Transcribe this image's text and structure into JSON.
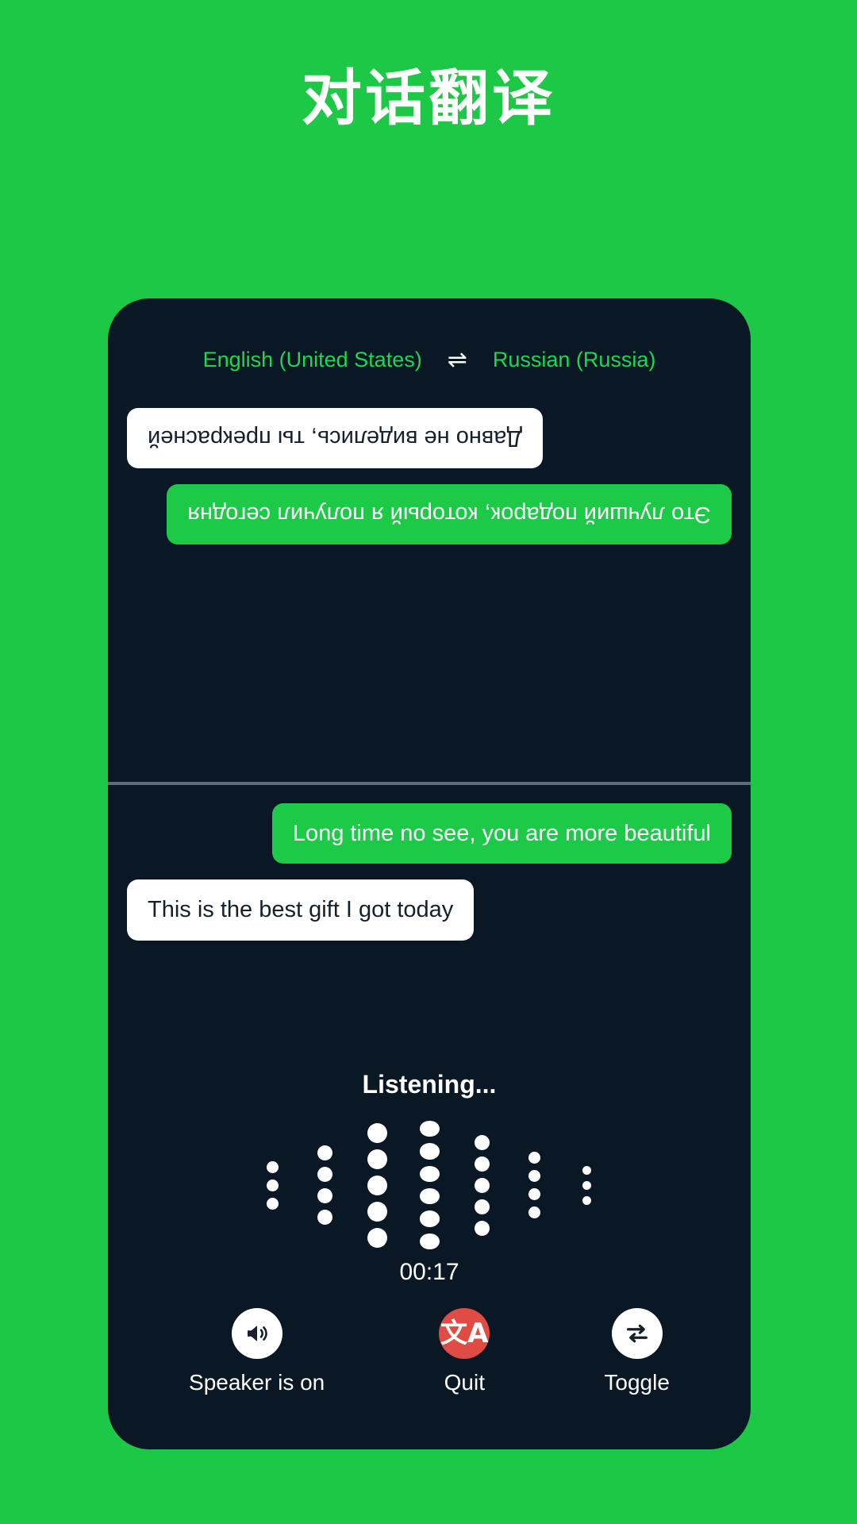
{
  "header": {
    "title": "对话翻译"
  },
  "card": {
    "language_bar": {
      "source_language": "English (United States)",
      "swap_icon": "swap-arrows-icon",
      "swap_glyph": "⇌",
      "target_language": "Russian (Russia)"
    },
    "translated_pane": {
      "rotated": true,
      "messages": [
        {
          "text": "Это лучший подарок, который я получил сегодня",
          "style": "green",
          "align": "left"
        },
        {
          "text": "Давно не виделись, ты прекрасней",
          "style": "white",
          "align": "right"
        }
      ]
    },
    "source_pane": {
      "rotated": false,
      "messages": [
        {
          "text": "Long time no see, you are more beautiful",
          "style": "green",
          "align": "right"
        },
        {
          "text": "This is the best gift I got today",
          "style": "white",
          "align": "left"
        }
      ]
    },
    "status": {
      "listening_label": "Listening...",
      "timer": "00:17"
    },
    "waveform": {
      "columns": [
        {
          "dots": 3,
          "size": 15
        },
        {
          "dots": 4,
          "size": 19
        },
        {
          "dots": 5,
          "size": 25
        },
        {
          "dots": 6,
          "size": 25
        },
        {
          "dots": 5,
          "size": 19
        },
        {
          "dots": 4,
          "size": 15
        },
        {
          "dots": 3,
          "size": 11
        }
      ]
    },
    "controls": [
      {
        "icon": "speaker-on-icon",
        "label": "Speaker is on",
        "circle": "white"
      },
      {
        "icon": "translate-icon",
        "label": "Quit",
        "circle": "red",
        "glyph": "文A"
      },
      {
        "icon": "toggle-swap-icon",
        "label": "Toggle",
        "circle": "white"
      }
    ]
  },
  "colors": {
    "background_green": "#1dc847",
    "bubble_green": "#1dca47",
    "card_dark": "#0a1826",
    "accent_red": "#e04b43",
    "lang_text_green": "#18d94f",
    "divider": "#5d6b7a"
  }
}
